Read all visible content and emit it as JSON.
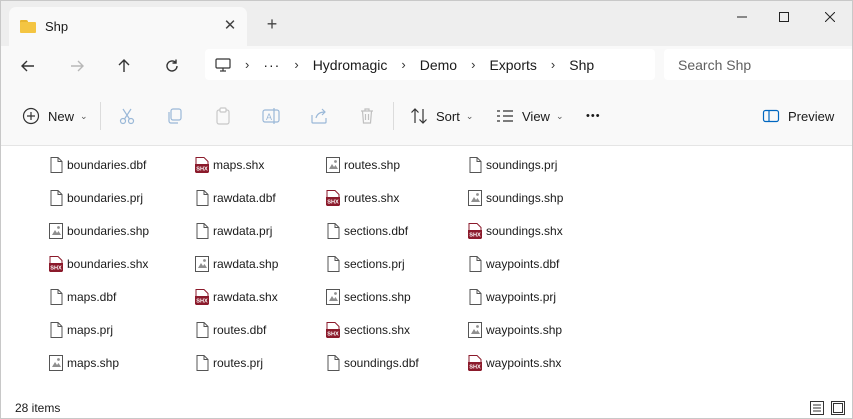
{
  "window": {
    "tab_title": "Shp",
    "tab_close_glyph": "✕",
    "new_tab_glyph": "+"
  },
  "breadcrumb": [
    "Hydromagic",
    "Demo",
    "Exports",
    "Shp"
  ],
  "search": {
    "placeholder": "Search Shp"
  },
  "commands": {
    "new_label": "New",
    "sort_label": "Sort",
    "view_label": "View",
    "more_glyph": "•••",
    "preview_label": "Preview"
  },
  "files": [
    {
      "name": "boundaries.dbf",
      "icon": "doc"
    },
    {
      "name": "boundaries.prj",
      "icon": "doc"
    },
    {
      "name": "boundaries.shp",
      "icon": "shp"
    },
    {
      "name": "boundaries.shx",
      "icon": "shx"
    },
    {
      "name": "maps.dbf",
      "icon": "doc"
    },
    {
      "name": "maps.prj",
      "icon": "doc"
    },
    {
      "name": "maps.shp",
      "icon": "shp"
    },
    {
      "name": "maps.shx",
      "icon": "shx"
    },
    {
      "name": "rawdata.dbf",
      "icon": "doc"
    },
    {
      "name": "rawdata.prj",
      "icon": "doc"
    },
    {
      "name": "rawdata.shp",
      "icon": "shp"
    },
    {
      "name": "rawdata.shx",
      "icon": "shx"
    },
    {
      "name": "routes.dbf",
      "icon": "doc"
    },
    {
      "name": "routes.prj",
      "icon": "doc"
    },
    {
      "name": "routes.shp",
      "icon": "shp"
    },
    {
      "name": "routes.shx",
      "icon": "shx"
    },
    {
      "name": "sections.dbf",
      "icon": "doc"
    },
    {
      "name": "sections.prj",
      "icon": "doc"
    },
    {
      "name": "sections.shp",
      "icon": "shp"
    },
    {
      "name": "sections.shx",
      "icon": "shx"
    },
    {
      "name": "soundings.dbf",
      "icon": "doc"
    },
    {
      "name": "soundings.prj",
      "icon": "doc"
    },
    {
      "name": "soundings.shp",
      "icon": "shp"
    },
    {
      "name": "soundings.shx",
      "icon": "shx"
    },
    {
      "name": "waypoints.dbf",
      "icon": "doc"
    },
    {
      "name": "waypoints.prj",
      "icon": "doc"
    },
    {
      "name": "waypoints.shp",
      "icon": "shp"
    },
    {
      "name": "waypoints.shx",
      "icon": "shx"
    }
  ],
  "status": {
    "item_count": "28 items"
  },
  "colors": {
    "folder": "#f4c542",
    "shx_badge": "#8b1a2b",
    "accent": "#0067c0"
  }
}
